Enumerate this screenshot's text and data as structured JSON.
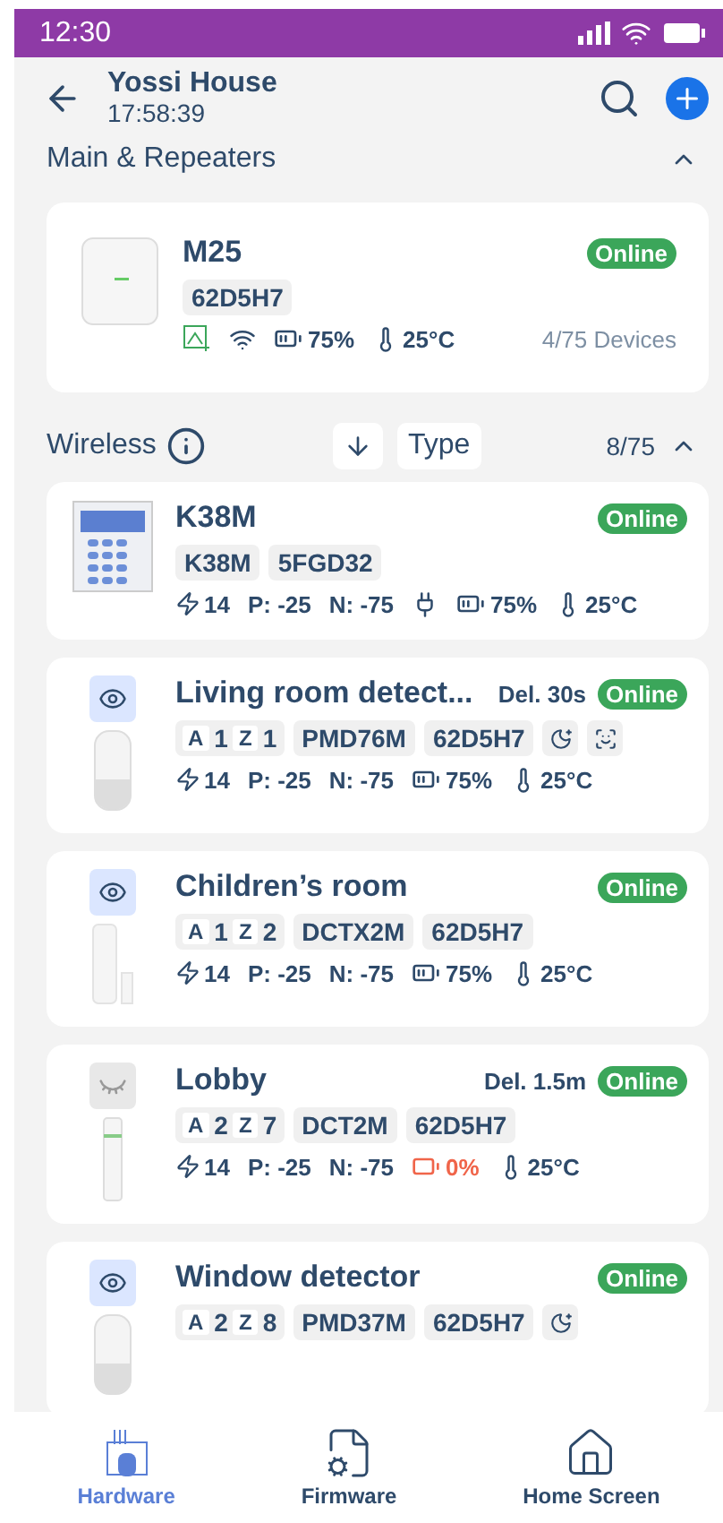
{
  "status_bar": {
    "time": "12:30"
  },
  "header": {
    "title": "Yossi House",
    "subtitle": "17:58:39"
  },
  "main_section": {
    "title": "Main & Repeaters",
    "expanded": true,
    "device": {
      "kind": "hub",
      "name": "M25",
      "online": true,
      "status_label": "Online",
      "tags": [
        "62D5H7"
      ],
      "battery": "75%",
      "temperature": "25°C",
      "devices": "4/75 Devices"
    }
  },
  "wireless_section": {
    "title": "Wireless",
    "sort": "Type",
    "count": "8/75",
    "expanded": true,
    "devices": [
      {
        "kind": "keypad",
        "name": "K38M",
        "online": true,
        "status_label": "Online",
        "tags": [
          "K38M",
          "5FGD32"
        ],
        "signal": "14",
        "p": "P: -25",
        "n": "N: -75",
        "plugged": true,
        "battery": "75%",
        "battery_low": false,
        "temperature": "25°C"
      },
      {
        "kind": "pir",
        "watching": true,
        "name": "Living room detect...",
        "delay": "Del. 30s",
        "online": true,
        "status_label": "Online",
        "zone": {
          "area_label": "A",
          "area": "1",
          "zone_label": "Z",
          "zone": "1"
        },
        "tags": [
          "PMD76M",
          "62D5H7"
        ],
        "night": true,
        "home": true,
        "signal": "14",
        "p": "P: -25",
        "n": "N: -75",
        "plugged": false,
        "battery": "75%",
        "battery_low": false,
        "temperature": "25°C"
      },
      {
        "kind": "contact",
        "watching": true,
        "name": "Children’s room",
        "online": true,
        "status_label": "Online",
        "zone": {
          "area_label": "A",
          "area": "1",
          "zone_label": "Z",
          "zone": "2"
        },
        "tags": [
          "DCTX2M",
          "62D5H7"
        ],
        "signal": "14",
        "p": "P: -25",
        "n": "N: -75",
        "plugged": false,
        "battery": "75%",
        "battery_low": false,
        "temperature": "25°C"
      },
      {
        "kind": "slim",
        "watching": false,
        "name": "Lobby",
        "delay": "Del. 1.5m",
        "online": true,
        "status_label": "Online",
        "zone": {
          "area_label": "A",
          "area": "2",
          "zone_label": "Z",
          "zone": "7"
        },
        "tags": [
          "DCT2M",
          "62D5H7"
        ],
        "signal": "14",
        "p": "P: -25",
        "n": "N: -75",
        "plugged": false,
        "battery": "0%",
        "battery_low": true,
        "temperature": "25°C"
      },
      {
        "kind": "pir",
        "watching": true,
        "name": "Window detector",
        "online": true,
        "status_label": "Online",
        "zone": {
          "area_label": "A",
          "area": "2",
          "zone_label": "Z",
          "zone": "8"
        },
        "tags": [
          "PMD37M",
          "62D5H7"
        ],
        "night": true
      }
    ]
  },
  "nav": [
    {
      "label": "Hardware",
      "selected": true
    },
    {
      "label": "Firmware",
      "selected": false
    },
    {
      "label": "Home Screen",
      "selected": false
    }
  ]
}
